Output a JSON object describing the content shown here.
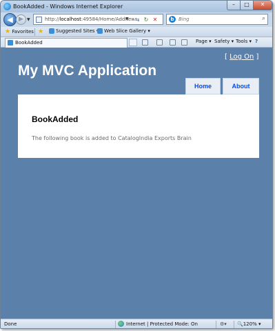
{
  "window": {
    "title": "BookAdded - Windows Internet Explorer",
    "min_glyph": "–",
    "max_glyph": "□",
    "close_glyph": "✕"
  },
  "navigation": {
    "back_glyph": "◀",
    "forward_glyph": "▶",
    "dropdown_glyph": "▼",
    "address_prefix": "http://",
    "address_host": "localhost",
    "address_rest": ":49584/Home/Addnew",
    "search_placeholder": "Bing",
    "search_glyph": "⌕",
    "refresh_glyph": "↻",
    "stop_glyph": "✕",
    "compat_glyph": "⇆"
  },
  "favorites_bar": {
    "favorites_label": "Favorites",
    "suggested_label": "Suggested Sites ▾",
    "webslice_label": "Web Slice Gallery ▾"
  },
  "command_bar": {
    "tab_label": "BookAdded",
    "page_label": "Page ▾",
    "safety_label": "Safety ▾",
    "tools_label": "Tools ▾",
    "help_label": "?"
  },
  "site": {
    "login_open": "[",
    "login_label": "Log On",
    "login_close": "]",
    "title": "My MVC Application",
    "menu": [
      {
        "label": "Home"
      },
      {
        "label": "About"
      }
    ],
    "heading": "BookAdded",
    "message": "The following book is added to CatalogIndia Exports Brain"
  },
  "status_bar": {
    "status": "Done",
    "zone": "Internet | Protected Mode: On",
    "zoom": "120%"
  },
  "colors": {
    "page_background": "#5b80aa",
    "panel_background": "#ffffff",
    "menu_link": "#034af3"
  }
}
